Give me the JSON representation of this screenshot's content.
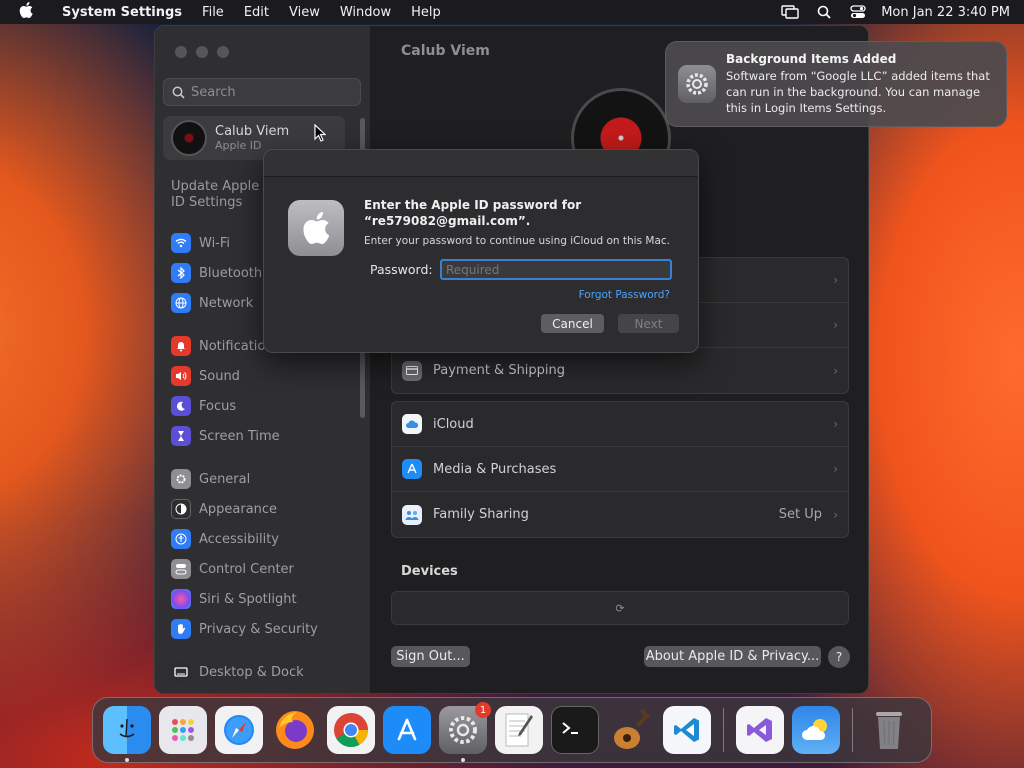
{
  "menubar": {
    "apple_icon": "",
    "app_name": "System Settings",
    "menus": [
      "File",
      "Edit",
      "View",
      "Window",
      "Help"
    ],
    "datetime": "Mon Jan 22  3:40 PM"
  },
  "sidebar": {
    "search_placeholder": "Search",
    "account_name": "Calub Viem",
    "account_sub": "Apple ID",
    "update_text": "Update Apple ID Settings",
    "items": [
      {
        "label": "Wi-Fi",
        "icon": "wifi-icon",
        "color": "#2f7cf6"
      },
      {
        "label": "Bluetooth",
        "icon": "bluetooth-icon",
        "color": "#2f7cf6"
      },
      {
        "label": "Network",
        "icon": "globe-icon",
        "color": "#2f7cf6"
      },
      {
        "label": "Notifications",
        "icon": "bell-icon",
        "color": "#e5392c"
      },
      {
        "label": "Sound",
        "icon": "speaker-icon",
        "color": "#e5392c"
      },
      {
        "label": "Focus",
        "icon": "moon-icon",
        "color": "#5b4fd6"
      },
      {
        "label": "Screen Time",
        "icon": "hourglass-icon",
        "color": "#5b4fd6"
      },
      {
        "label": "General",
        "icon": "gear-icon",
        "color": "#8e8e93"
      },
      {
        "label": "Appearance",
        "icon": "appearance-icon",
        "color": "#2d2d30"
      },
      {
        "label": "Accessibility",
        "icon": "accessibility-icon",
        "color": "#2f7cf6"
      },
      {
        "label": "Control Center",
        "icon": "control-center-icon",
        "color": "#8e8e93"
      },
      {
        "label": "Siri & Spotlight",
        "icon": "siri-icon",
        "color": "#c04bd0"
      },
      {
        "label": "Privacy & Security",
        "icon": "hand-icon",
        "color": "#2f7cf6"
      },
      {
        "label": "Desktop & Dock",
        "icon": "desktop-icon",
        "color": "#2d2d30"
      }
    ]
  },
  "main": {
    "title": "Calub Viem",
    "payment_row": "Payment & Shipping",
    "rows": [
      {
        "label": "iCloud",
        "icon": "icloud-icon",
        "value": ""
      },
      {
        "label": "Media & Purchases",
        "icon": "appstore-icon",
        "value": ""
      },
      {
        "label": "Family Sharing",
        "icon": "family-icon",
        "value": "Set Up"
      }
    ],
    "devices_title": "Devices",
    "sign_out": "Sign Out...",
    "about": "About Apple ID & Privacy...",
    "help": "?"
  },
  "dialog": {
    "title_line1": "Enter the Apple ID password for",
    "title_line2": "“re579082@gmail.com”.",
    "subtitle": "Enter your password to continue using iCloud on this Mac.",
    "password_label": "Password:",
    "password_placeholder": "Required",
    "forgot": "Forgot Password?",
    "cancel": "Cancel",
    "next": "Next"
  },
  "notification": {
    "title": "Background Items Added",
    "body": "Software from “Google LLC” added items that can run in the background. You can manage this in Login Items Settings."
  },
  "dock": {
    "apps": [
      {
        "name": "finder-icon",
        "bg": "#2b8cf0",
        "badge": "",
        "dot": true
      },
      {
        "name": "launchpad-icon",
        "bg": "#e8e8ec",
        "badge": "",
        "dot": false
      },
      {
        "name": "safari-icon",
        "bg": "#f2f2f4",
        "badge": "",
        "dot": false
      },
      {
        "name": "firefox-icon",
        "bg": "#ff8a1c",
        "badge": "",
        "dot": false
      },
      {
        "name": "chrome-icon",
        "bg": "#f2f2f4",
        "badge": "",
        "dot": false
      },
      {
        "name": "appstore-icon",
        "bg": "#1d8cf8",
        "badge": "",
        "dot": false
      },
      {
        "name": "system-settings-icon",
        "bg": "#8e8e93",
        "badge": "1",
        "dot": true
      },
      {
        "name": "textedit-icon",
        "bg": "#f2f2f2",
        "badge": "",
        "dot": false
      },
      {
        "name": "terminal-icon",
        "bg": "#1a1a1a",
        "badge": "",
        "dot": false
      },
      {
        "name": "garageband-icon",
        "bg": "#c98033",
        "badge": "",
        "dot": false
      },
      {
        "name": "vscode-icon",
        "bg": "#f5f7fa",
        "badge": "",
        "dot": false
      },
      {
        "name": "visual-studio-icon",
        "bg": "#f5f5f8",
        "badge": "",
        "dot": false
      },
      {
        "name": "weather-icon",
        "bg": "#2e86e8",
        "badge": "",
        "dot": false
      },
      {
        "name": "trash-icon",
        "bg": "transparent",
        "badge": "",
        "dot": false
      }
    ]
  }
}
